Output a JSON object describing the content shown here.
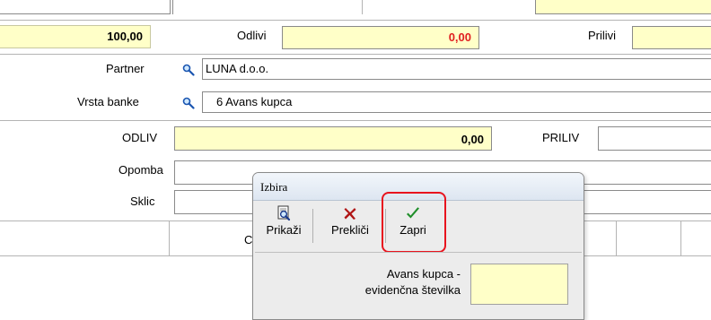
{
  "form": {
    "top_value": "100,00",
    "odlivi_label": "Odlivi",
    "odlivi_value": "0,00",
    "prilivi_label": "Prilivi",
    "partner_label": "Partner",
    "partner_value": "LUNA d.o.o.",
    "vrsta_banke_label": "Vrsta banke",
    "vrsta_banke_value": "6 Avans kupca",
    "odliv_label": "ODLIV",
    "odliv_value": "0,00",
    "priliv_label": "PRILIV",
    "opomba_label": "Opomba",
    "sklic_label": "Sklic",
    "partial_button_text": "C"
  },
  "dialog": {
    "title": "Izbira",
    "buttons": [
      {
        "label": "Prikaži",
        "icon": "preview-icon"
      },
      {
        "label": "Prekliči",
        "icon": "cancel-x-icon"
      },
      {
        "label": "Zapri",
        "icon": "checkmark-icon"
      }
    ],
    "field_label_line1": "Avans kupca -",
    "field_label_line2": "evidenčna številka",
    "field_value": ""
  },
  "colors": {
    "field_yellow": "#ffffc8",
    "odlivi_red": "#e02020",
    "highlight_red": "#e8141e",
    "check_green": "#1f8f2a"
  }
}
